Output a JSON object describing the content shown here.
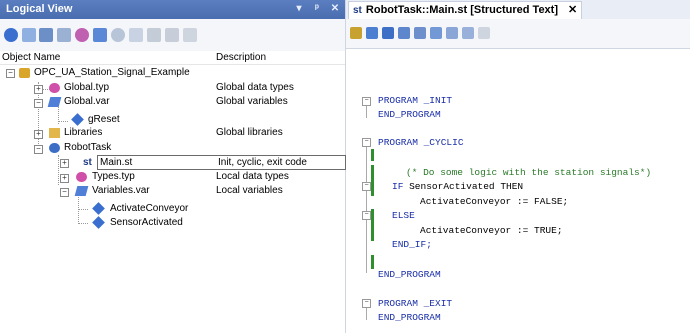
{
  "left_panel": {
    "title": "Logical View",
    "title_buttons": [
      "▾",
      "ᵖ",
      "✕"
    ],
    "columns": {
      "name": "Object Name",
      "description": "Description"
    },
    "tree": [
      {
        "label": "OPC_UA_Station_Signal_Example",
        "desc": ""
      },
      {
        "label": "Global.typ",
        "desc": "Global data types"
      },
      {
        "label": "Global.var",
        "desc": "Global variables"
      },
      {
        "label": "gReset",
        "desc": ""
      },
      {
        "label": "Libraries",
        "desc": "Global libraries"
      },
      {
        "label": "RobotTask",
        "desc": ""
      },
      {
        "label": "Main.st",
        "desc": "Init, cyclic, exit code"
      },
      {
        "label": "Types.typ",
        "desc": "Local data types"
      },
      {
        "label": "Variables.var",
        "desc": "Local variables"
      },
      {
        "label": "ActivateConveyor",
        "desc": ""
      },
      {
        "label": "SensorActivated",
        "desc": ""
      }
    ]
  },
  "editor": {
    "tab_icon": "st",
    "tab_title": "RobotTask::Main.st [Structured Text]",
    "tab_close": "✕",
    "code": [
      "PROGRAM _INIT",
      "END_PROGRAM",
      "PROGRAM _CYCLIC",
      "(* Do some logic with the station signals*)",
      "IF SensorActivated THEN",
      "ActivateConveyor := FALSE;",
      "ELSE",
      "ActivateConveyor := TRUE;",
      "END_IF;",
      "END_PROGRAM",
      "PROGRAM _EXIT",
      "END_PROGRAM"
    ]
  },
  "colors": {
    "title_bar": "#4a6db0",
    "keyword": "#1a2fa8",
    "comment": "#2a7a2a",
    "change_bar": "#2f8f2f"
  }
}
